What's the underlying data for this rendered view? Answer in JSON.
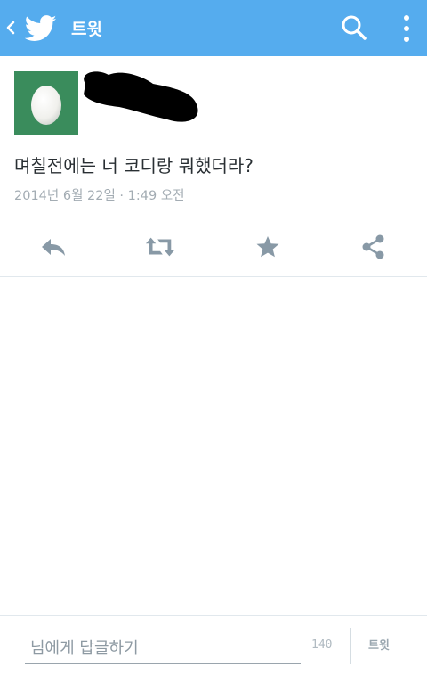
{
  "appbar": {
    "title": "트윗",
    "icons": [
      "back-chevron-icon",
      "twitter-bird-icon",
      "search-icon",
      "overflow-menu-icon"
    ]
  },
  "tweet": {
    "text": "며칠전에는 너 코디랑 뭐했더라?",
    "meta": "2014년 6월 22일 · 1:49 오전",
    "avatar_icon": "default-egg-avatar"
  },
  "actions": [
    {
      "name": "reply",
      "icon": "reply-icon"
    },
    {
      "name": "retweet",
      "icon": "retweet-icon"
    },
    {
      "name": "favorite",
      "icon": "star-icon"
    },
    {
      "name": "share",
      "icon": "share-icon"
    }
  ],
  "reply_bar": {
    "placeholder": "님에게 답글하기",
    "char_count": "140",
    "tweet_button": "트윗"
  },
  "colors": {
    "appbar": "#55acee",
    "icon_gray": "#8899a6",
    "text": "#292f33",
    "meta": "#a3acb3"
  }
}
